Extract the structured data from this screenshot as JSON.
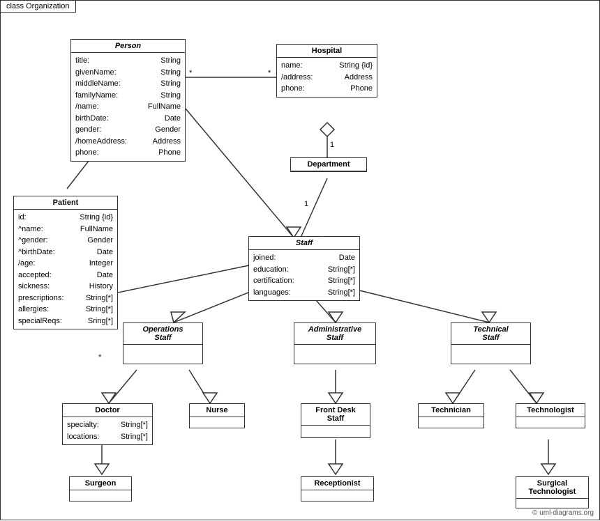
{
  "diagram": {
    "title": "class Organization",
    "copyright": "© uml-diagrams.org",
    "boxes": {
      "person": {
        "title": "Person",
        "italic": true,
        "attrs": [
          {
            "name": "title:",
            "type": "String"
          },
          {
            "name": "givenName:",
            "type": "String"
          },
          {
            "name": "middleName:",
            "type": "String"
          },
          {
            "name": "familyName:",
            "type": "String"
          },
          {
            "name": "/name:",
            "type": "FullName"
          },
          {
            "name": "birthDate:",
            "type": "Date"
          },
          {
            "name": "gender:",
            "type": "Gender"
          },
          {
            "name": "/homeAddress:",
            "type": "Address"
          },
          {
            "name": "phone:",
            "type": "Phone"
          }
        ]
      },
      "hospital": {
        "title": "Hospital",
        "italic": false,
        "attrs": [
          {
            "name": "name:",
            "type": "String {id}"
          },
          {
            "name": "/address:",
            "type": "Address"
          },
          {
            "name": "phone:",
            "type": "Phone"
          }
        ]
      },
      "department": {
        "title": "Department",
        "italic": false,
        "attrs": []
      },
      "staff": {
        "title": "Staff",
        "italic": true,
        "attrs": [
          {
            "name": "joined:",
            "type": "Date"
          },
          {
            "name": "education:",
            "type": "String[*]"
          },
          {
            "name": "certification:",
            "type": "String[*]"
          },
          {
            "name": "languages:",
            "type": "String[*]"
          }
        ]
      },
      "patient": {
        "title": "Patient",
        "italic": false,
        "attrs": [
          {
            "name": "id:",
            "type": "String {id}"
          },
          {
            "name": "^name:",
            "type": "FullName"
          },
          {
            "name": "^gender:",
            "type": "Gender"
          },
          {
            "name": "^birthDate:",
            "type": "Date"
          },
          {
            "name": "/age:",
            "type": "Integer"
          },
          {
            "name": "accepted:",
            "type": "Date"
          },
          {
            "name": "sickness:",
            "type": "History"
          },
          {
            "name": "prescriptions:",
            "type": "String[*]"
          },
          {
            "name": "allergies:",
            "type": "String[*]"
          },
          {
            "name": "specialReqs:",
            "type": "Sring[*]"
          }
        ]
      },
      "operations_staff": {
        "title": "Operations\nStaff",
        "italic": true,
        "attrs": []
      },
      "administrative_staff": {
        "title": "Administrative\nStaff",
        "italic": true,
        "attrs": []
      },
      "technical_staff": {
        "title": "Technical\nStaff",
        "italic": true,
        "attrs": []
      },
      "doctor": {
        "title": "Doctor",
        "italic": false,
        "attrs": [
          {
            "name": "specialty:",
            "type": "String[*]"
          },
          {
            "name": "locations:",
            "type": "String[*]"
          }
        ]
      },
      "nurse": {
        "title": "Nurse",
        "italic": false,
        "attrs": []
      },
      "front_desk_staff": {
        "title": "Front Desk\nStaff",
        "italic": false,
        "attrs": []
      },
      "technician": {
        "title": "Technician",
        "italic": false,
        "attrs": []
      },
      "technologist": {
        "title": "Technologist",
        "italic": false,
        "attrs": []
      },
      "surgeon": {
        "title": "Surgeon",
        "italic": false,
        "attrs": []
      },
      "receptionist": {
        "title": "Receptionist",
        "italic": false,
        "attrs": []
      },
      "surgical_technologist": {
        "title": "Surgical\nTechnologist",
        "italic": false,
        "attrs": []
      }
    }
  }
}
